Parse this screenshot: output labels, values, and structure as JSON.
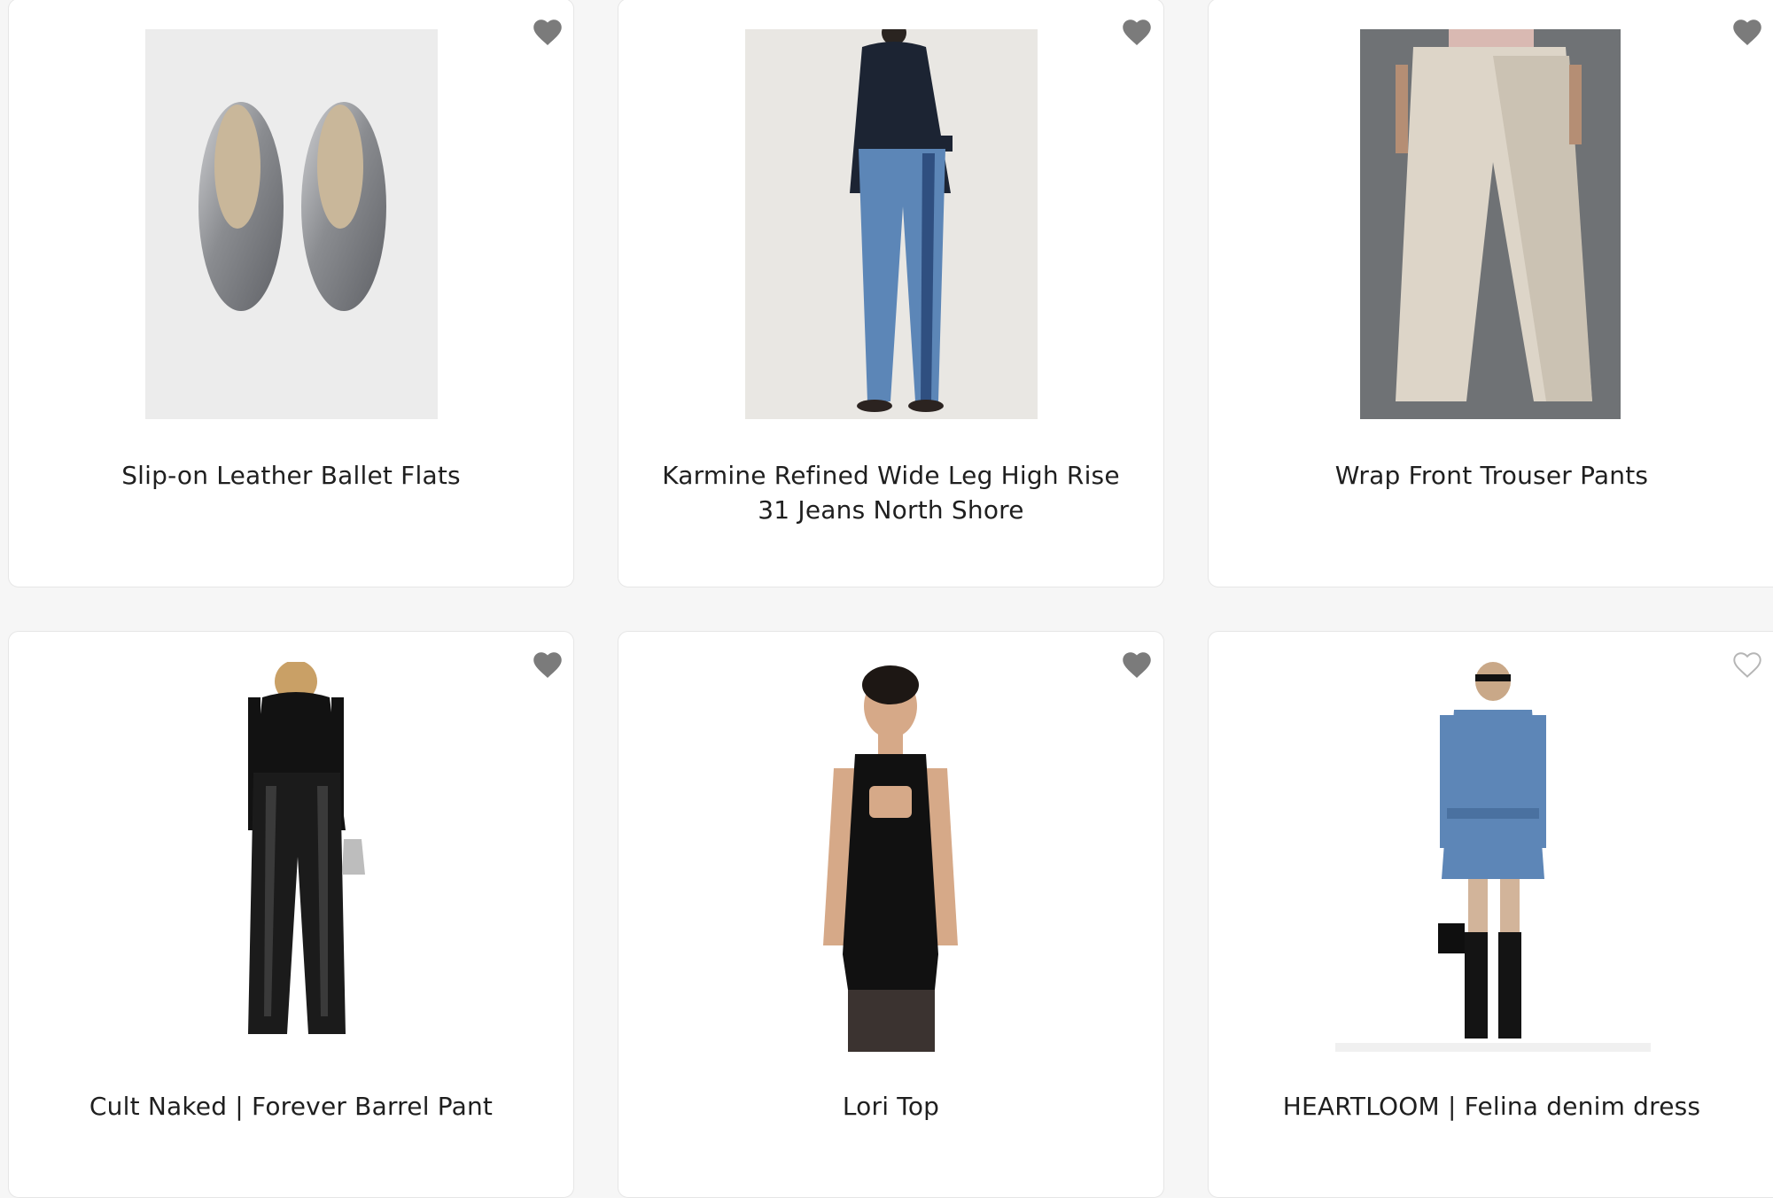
{
  "products": [
    {
      "title": "Slip-on Leather Ballet Flats",
      "favorited": true,
      "image_icon": "ballet-flats-photo"
    },
    {
      "title": "Karmine Refined Wide Leg High Rise 31 Jeans North Shore",
      "favorited": true,
      "image_icon": "jeans-photo"
    },
    {
      "title": "Wrap Front Trouser Pants",
      "favorited": true,
      "image_icon": "trouser-pants-photo"
    },
    {
      "title": "Cult Naked | Forever Barrel Pant",
      "favorited": true,
      "image_icon": "barrel-pant-photo"
    },
    {
      "title": "Lori Top",
      "favorited": true,
      "image_icon": "lori-top-photo"
    },
    {
      "title": "HEARTLOOM | Felina denim dress",
      "favorited": false,
      "image_icon": "denim-dress-photo"
    }
  ],
  "colors": {
    "heart_filled": "#7b7b7b",
    "heart_outline": "#b5b5b5",
    "page_bg": "#f6f6f6",
    "card_bg": "#ffffff"
  }
}
